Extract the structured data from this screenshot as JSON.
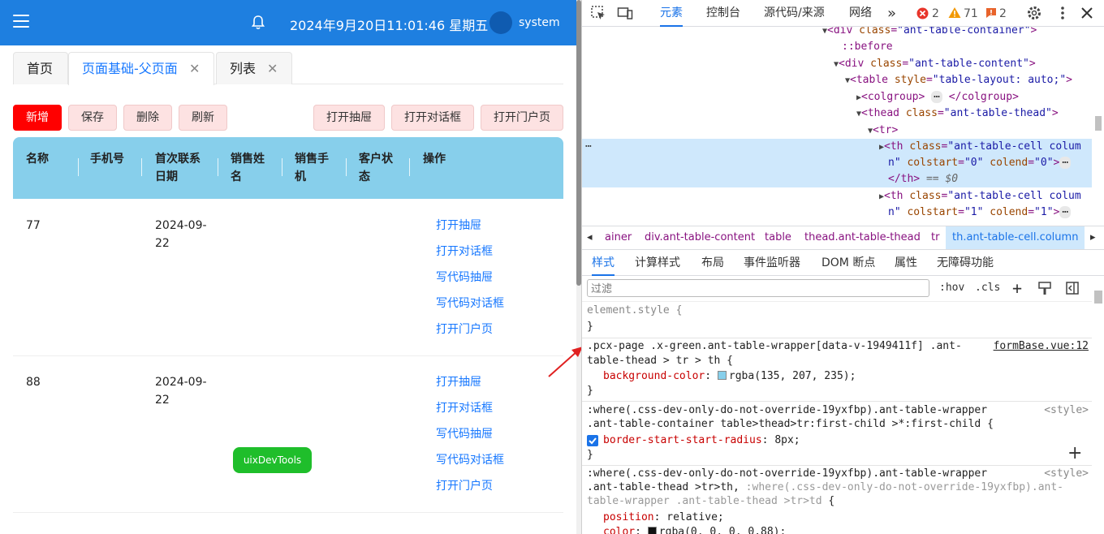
{
  "app": {
    "datetime": "2024年9月20日11:01:46 星期五",
    "username": "system",
    "tabs": [
      {
        "label": "首页"
      },
      {
        "label": "页面基础-父页面",
        "close": "✕"
      },
      {
        "label": "列表",
        "close": "✕"
      }
    ],
    "toolbar": {
      "add": "新增",
      "save": "保存",
      "delete": "删除",
      "refresh": "刷新",
      "open_drawer": "打开抽屉",
      "open_dialog": "打开对话框",
      "open_portal": "打开门户页"
    },
    "table": {
      "headers": {
        "name": "名称",
        "phone": "手机号",
        "first_contact": [
          "首次联系",
          "日期"
        ],
        "sales_name": [
          "销售姓",
          "名"
        ],
        "sales_phone": [
          "销售手",
          "机"
        ],
        "customer_status": [
          "客户状",
          "态"
        ],
        "actions": "操作"
      },
      "rows": [
        {
          "name": "77",
          "date": [
            "2024-09-",
            "22"
          ],
          "actions": [
            "打开抽屉",
            "打开对话框",
            "写代码抽屉",
            "写代码对话框",
            "打开门户页"
          ]
        },
        {
          "name": "88",
          "date": [
            "2024-09-",
            "22"
          ],
          "actions": [
            "打开抽屉",
            "打开对话框",
            "写代码抽屉",
            "写代码对话框",
            "打开门户页"
          ]
        }
      ]
    },
    "uix_button": "uixDevTools"
  },
  "devtools": {
    "tabs": {
      "elements": "元素",
      "console": "控制台",
      "sources": "源代码/来源",
      "network": "网络"
    },
    "counts": {
      "errors": "2",
      "warnings": "71",
      "issues": "2"
    },
    "dom": {
      "l1_tag": "div",
      "l1_attr": "class",
      "l1_val": "\"ant-table-container\"",
      "l2": "::before",
      "l3_tag": "div",
      "l3_attr": "class",
      "l3_val": "\"ant-table-content\"",
      "l4_tag": "table",
      "l4_attr": "style",
      "l4_val": "\"table-layout: auto;\"",
      "l5_open": "<colgroup>",
      "l5_close": "</colgroup>",
      "l6_tag": "thead",
      "l6_attr": "class",
      "l6_val": "\"ant-table-thead\"",
      "l7": "<tr>",
      "sel_a_tag": "th",
      "sel_a_attr": "class",
      "sel_a_val": "\"ant-table-cell colum",
      "sel_b_val1": "n\"",
      "sel_b_attr2": "colstart",
      "sel_b_val2": "\"0\"",
      "sel_b_attr3": "colend",
      "sel_b_val3": "\"0\"",
      "sel_c": "</th>",
      "sel_c_eq": "== $0",
      "n_a_tag": "th",
      "n_a_attr": "class",
      "n_a_val": "\"ant-table-cell colum",
      "n_b_val1": "n\"",
      "n_b_attr2": "colstart",
      "n_b_val2": "\"1\"",
      "n_b_attr3": "colend",
      "n_b_val3": "\"1\""
    },
    "breadcrumbs": [
      "ainer",
      "div.ant-table-content",
      "table",
      "thead.ant-table-thead",
      "tr",
      "th.ant-table-cell.column"
    ],
    "subtabs": {
      "styles": "样式",
      "computed": "计算样式",
      "layout": "布局",
      "listeners": "事件监听器",
      "dom_breakpoints": "DOM 断点",
      "properties": "属性",
      "accessibility": "无障碍功能"
    },
    "filter_placeholder": "过滤",
    "filter_hov": ":hov",
    "filter_cls": ".cls",
    "styles": {
      "r0_sel": "element.style {",
      "close": "}",
      "r1_sel1": ".pcx-page .x-green.ant-table-wrapper[data-v-1949411f] .ant-",
      "r1_sel2": "table-thead > tr > th {",
      "r1_src": "formBase.vue:12",
      "r1_prop": "background-color",
      "r1_val": "rgba(135, 207, 235);",
      "r1_color": "#87cfeb",
      "r2_sel1": ":where(.css-dev-only-do-not-override-19yxfbp).ant-table-wrapper",
      "r2_sel2": ".ant-table-container table>thead>tr:first-child >*:first-child {",
      "r2_src": "<style>",
      "r2_prop": "border-start-start-radius",
      "r2_val": "8px;",
      "r3_sel1": ":where(.css-dev-only-do-not-override-19yxfbp).ant-table-wrapper",
      "r3_sel2a": ".ant-table-thead >tr>th,",
      "r3_sel2b": " :where(.css-dev-only-do-not-override-19yxfbp).ant-",
      "r3_sel3a": "table-wrapper .ant-table-thead >tr>td",
      "r3_sel3b": " {",
      "r3_src": "<style>",
      "r3_prop1": "position",
      "r3_val1": "relative;",
      "r3_prop2": "color",
      "r3_val2": "rgba(0, 0, 0, 0.88);"
    }
  }
}
